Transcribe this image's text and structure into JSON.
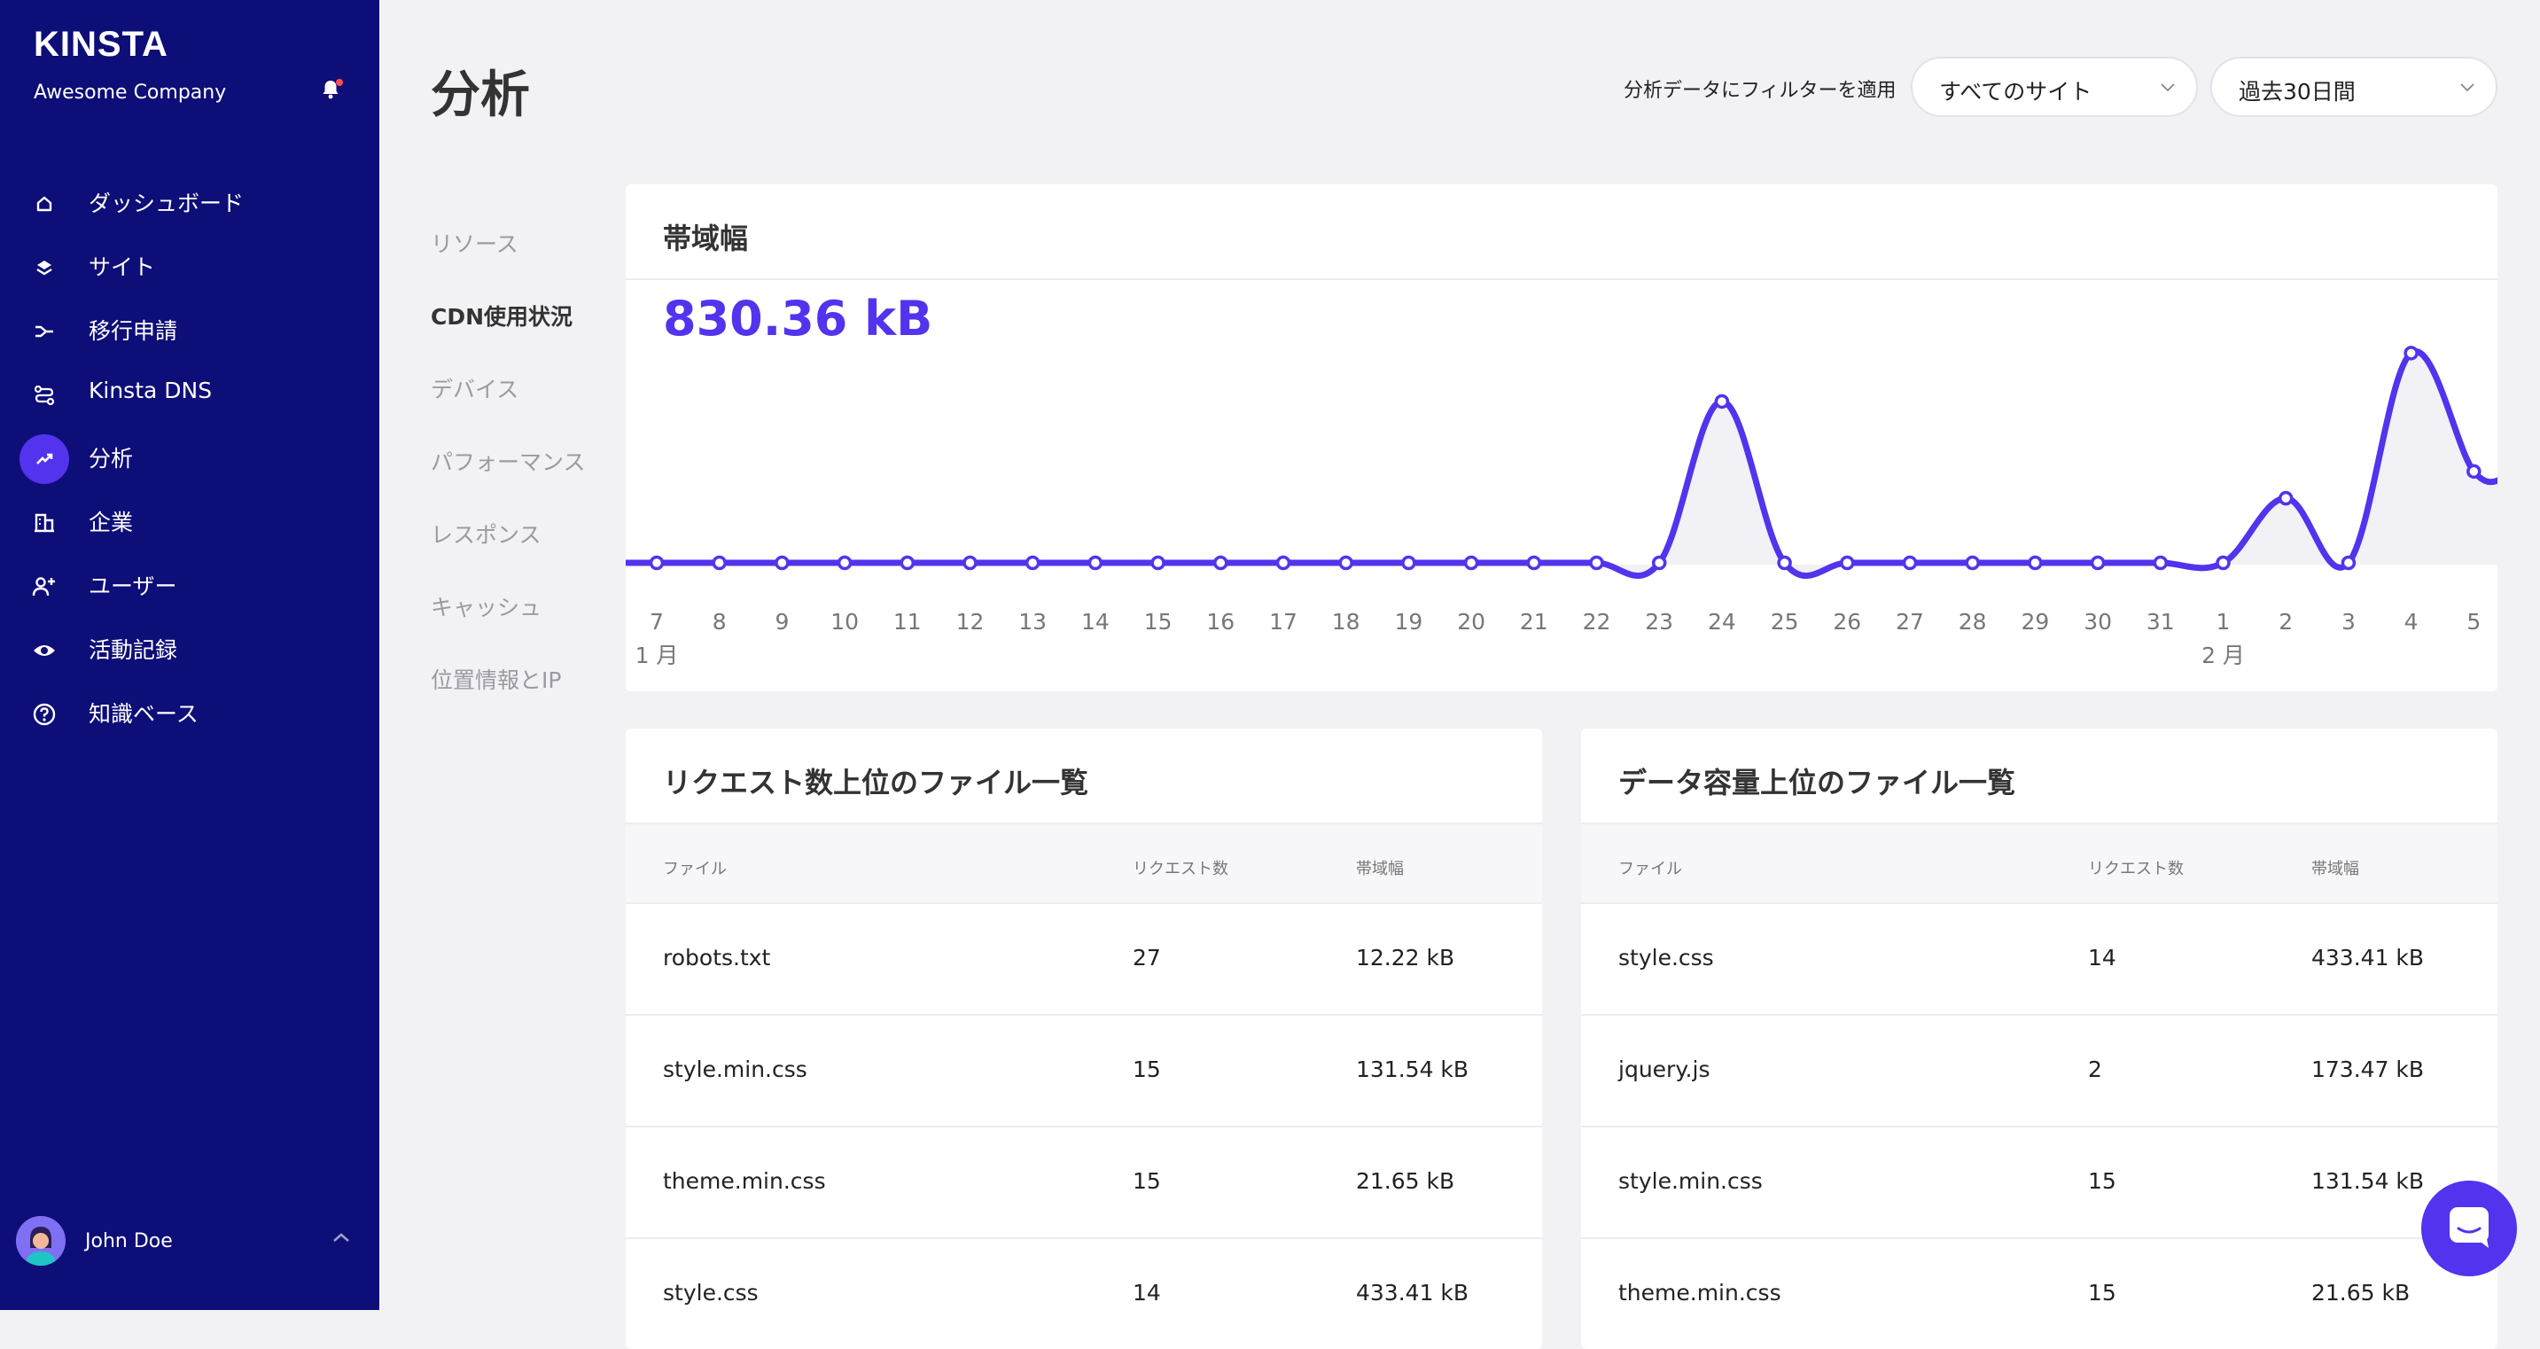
{
  "brand": {
    "logo": "KINSTA",
    "company": "Awesome Company"
  },
  "sidebar": {
    "items": [
      {
        "label": "ダッシュボード",
        "icon": "home-icon",
        "active": false
      },
      {
        "label": "サイト",
        "icon": "layers-icon",
        "active": false
      },
      {
        "label": "移行申請",
        "icon": "migration-icon",
        "active": false
      },
      {
        "label": "Kinsta DNS",
        "icon": "dns-icon",
        "active": false
      },
      {
        "label": "分析",
        "icon": "analytics-icon",
        "active": true
      },
      {
        "label": "企業",
        "icon": "company-icon",
        "active": false
      },
      {
        "label": "ユーザー",
        "icon": "user-add-icon",
        "active": false
      },
      {
        "label": "活動記録",
        "icon": "eye-icon",
        "active": false
      },
      {
        "label": "知識ベース",
        "icon": "help-icon",
        "active": false
      }
    ],
    "user": {
      "name": "John Doe"
    }
  },
  "header": {
    "title": "分析",
    "filter_label": "分析データにフィルターを適用",
    "site_select": "すべてのサイト",
    "range_select": "過去30日間"
  },
  "subnav": {
    "items": [
      {
        "label": "リソース",
        "active": false
      },
      {
        "label": "CDN使用状況",
        "active": true
      },
      {
        "label": "デバイス",
        "active": false
      },
      {
        "label": "パフォーマンス",
        "active": false
      },
      {
        "label": "レスポンス",
        "active": false
      },
      {
        "label": "キャッシュ",
        "active": false
      },
      {
        "label": "位置情報とIP",
        "active": false
      }
    ]
  },
  "bandwidth_card": {
    "title": "帯域幅",
    "total": "830.36 kB"
  },
  "chart_data": {
    "type": "line",
    "x": [
      "7",
      "8",
      "9",
      "10",
      "11",
      "12",
      "13",
      "14",
      "15",
      "16",
      "17",
      "18",
      "19",
      "20",
      "21",
      "22",
      "23",
      "24",
      "25",
      "26",
      "27",
      "28",
      "29",
      "30",
      "31",
      "1",
      "2",
      "3",
      "4",
      "5"
    ],
    "month_labels": [
      {
        "at": "7",
        "label": "1 月"
      },
      {
        "at": "1",
        "label": "2 月"
      }
    ],
    "series": [
      {
        "values": [
          0,
          0,
          0,
          0,
          0,
          0,
          0,
          0,
          0,
          0,
          0,
          0,
          0,
          0,
          0,
          0,
          0,
          150,
          0,
          0,
          0,
          0,
          0,
          0,
          0,
          0,
          60,
          0,
          195,
          85
        ]
      }
    ],
    "ylim": [
      0,
      220
    ],
    "color": "#5333ed",
    "grid": false
  },
  "top_requests": {
    "title": "リクエスト数上位のファイル一覧",
    "columns": [
      "ファイル",
      "リクエスト数",
      "帯域幅"
    ],
    "rows": [
      [
        "robots.txt",
        "27",
        "12.22 kB"
      ],
      [
        "style.min.css",
        "15",
        "131.54 kB"
      ],
      [
        "theme.min.css",
        "15",
        "21.65 kB"
      ],
      [
        "style.css",
        "14",
        "433.41 kB"
      ]
    ]
  },
  "top_size": {
    "title": "データ容量上位のファイル一覧",
    "columns": [
      "ファイル",
      "リクエスト数",
      "帯域幅"
    ],
    "rows": [
      [
        "style.css",
        "14",
        "433.41 kB"
      ],
      [
        "jquery.js",
        "2",
        "173.47 kB"
      ],
      [
        "style.min.css",
        "15",
        "131.54 kB"
      ],
      [
        "theme.min.css",
        "15",
        "21.65 kB"
      ]
    ]
  },
  "colors": {
    "sidebar": "#0e0e78",
    "accent": "#5333ed",
    "background": "#f2f2f5"
  }
}
